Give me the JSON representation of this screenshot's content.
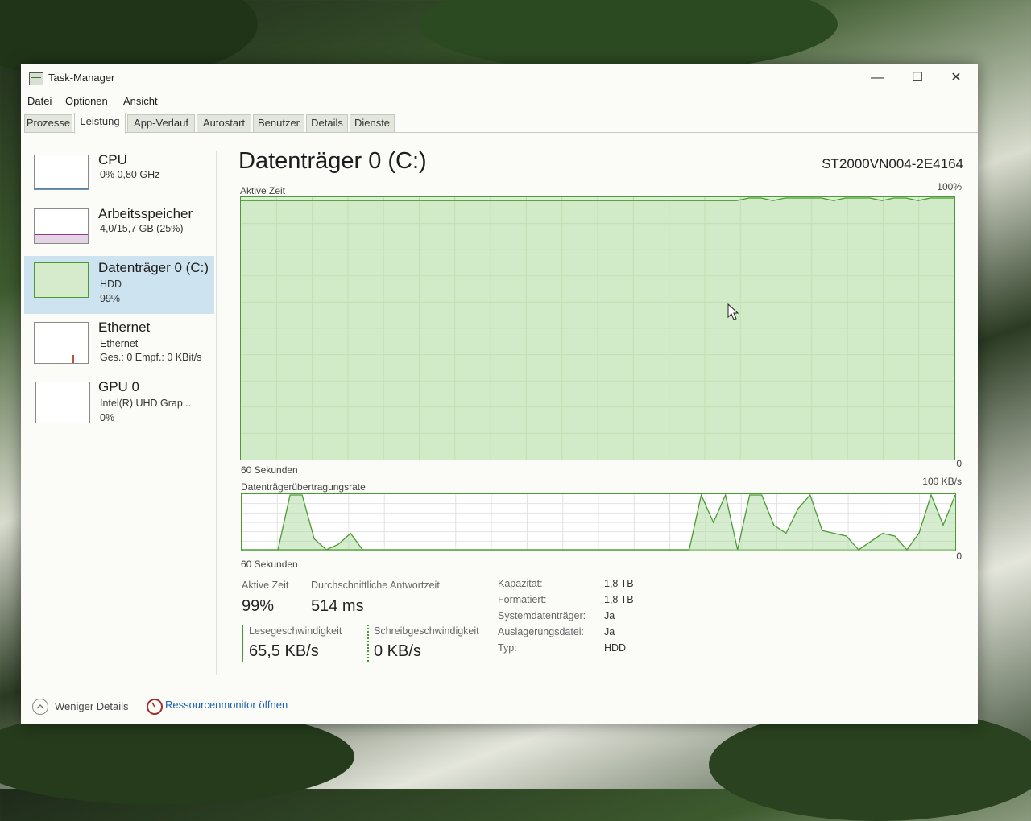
{
  "window": {
    "title": "Task-Manager",
    "controls": [
      "—",
      "☐",
      "✕"
    ]
  },
  "menu": [
    "Datei",
    "Optionen",
    "Ansicht"
  ],
  "tabs": [
    "Prozesse",
    "Leistung",
    "App-Verlauf",
    "Autostart",
    "Benutzer",
    "Details",
    "Dienste"
  ],
  "active_tab": "Leistung",
  "sidebar": [
    {
      "title": "CPU",
      "lines": [
        "0% 0,80 GHz"
      ]
    },
    {
      "title": "Arbeitsspeicher",
      "lines": [
        "4,0/15,7 GB (25%)"
      ]
    },
    {
      "title": "Datenträger 0 (C:)",
      "lines": [
        "HDD",
        "99%"
      ]
    },
    {
      "title": "Ethernet",
      "lines": [
        "Ethernet",
        "Ges.: 0 Empf.: 0 KBit/s"
      ]
    },
    {
      "title": "GPU 0",
      "lines": [
        "Intel(R) UHD Grap...",
        "0%"
      ]
    }
  ],
  "main": {
    "title": "Datenträger 0 (C:)",
    "model": "ST2000VN004-2E4164",
    "graph1": {
      "label": "Aktive Zeit",
      "max": "100%",
      "min": "0",
      "time": "60 Sekunden"
    },
    "graph2": {
      "label": "Datenträgerübertragungsrate",
      "max": "100 KB/s",
      "min": "0",
      "time": "60 Sekunden"
    }
  },
  "stats": {
    "active_time_label": "Aktive Zeit",
    "active_time_value": "99%",
    "response_label": "Durchschnittliche Antwortzeit",
    "response_value": "514 ms",
    "read_label": "Lesegeschwindigkeit",
    "read_value": "65,5 KB/s",
    "write_label": "Schreibgeschwindigkeit",
    "write_value": "0 KB/s"
  },
  "info": [
    {
      "key": "Kapazität:",
      "value": "1,8 TB"
    },
    {
      "key": "Formatiert:",
      "value": "1,8 TB"
    },
    {
      "key": "Systemdatenträger:",
      "value": "Ja"
    },
    {
      "key": "Auslagerungsdatei:",
      "value": "Ja"
    },
    {
      "key": "Typ:",
      "value": "HDD"
    }
  ],
  "footer": {
    "less_details": "Weniger Details",
    "resource_monitor": "Ressourcenmonitor öffnen"
  },
  "colors": {
    "graph_line": "#4b9b34",
    "graph_fill": "#dcefd4",
    "selected": "#cde3ef",
    "link": "#1a5fb4"
  },
  "chart_data": [
    {
      "type": "line",
      "title": "Aktive Zeit",
      "xlabel": "60 Sekunden",
      "ylim": [
        0,
        100
      ],
      "values": [
        99,
        99,
        99,
        99,
        99,
        99,
        99,
        99,
        99,
        99,
        99,
        99,
        99,
        99,
        99,
        99,
        99,
        99,
        99,
        99,
        99,
        99,
        99,
        99,
        99,
        99,
        99,
        99,
        99,
        99,
        99,
        99,
        99,
        99,
        99,
        99,
        99,
        99,
        99,
        99,
        99,
        99,
        100,
        100,
        99,
        100,
        100,
        100,
        100,
        99,
        100,
        100,
        100,
        99,
        100,
        100,
        99,
        100,
        100,
        100
      ]
    },
    {
      "type": "area",
      "title": "Datenträgerübertragungsrate",
      "xlabel": "60 Sekunden",
      "ylim": [
        0,
        100
      ],
      "series": [
        {
          "values": [
            0,
            0,
            0,
            0,
            100,
            100,
            20,
            0,
            10,
            30,
            0,
            0,
            0,
            0,
            0,
            0,
            0,
            0,
            0,
            0,
            0,
            0,
            0,
            0,
            0,
            0,
            0,
            0,
            0,
            0,
            0,
            0,
            0,
            0,
            0,
            0,
            0,
            0,
            0,
            0,
            0,
            0,
            0,
            0,
            0,
            0,
            0,
            0,
            0,
            0,
            0,
            0,
            0,
            0,
            0,
            0,
            0,
            0,
            0,
            0
          ]
        },
        {
          "values": [
            0,
            0,
            0,
            0,
            0,
            0,
            0,
            0,
            0,
            0,
            0,
            0,
            0,
            0,
            0,
            0,
            0,
            0,
            0,
            0,
            0,
            0,
            0,
            0,
            0,
            0,
            0,
            0,
            0,
            0,
            0,
            0,
            0,
            0,
            0,
            0,
            0,
            0,
            100,
            50,
            100,
            0,
            100,
            100,
            45,
            30,
            75,
            100,
            35,
            30,
            25,
            0,
            15,
            30,
            25,
            0,
            30,
            100,
            45,
            100
          ]
        }
      ]
    }
  ]
}
